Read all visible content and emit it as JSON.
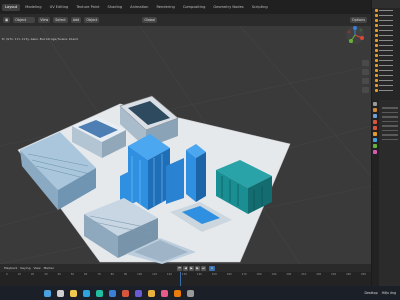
{
  "topbar": {
    "tabs": [
      "Layout",
      "Modeling",
      "UV Editing",
      "Texture Paint",
      "Shading",
      "Animation",
      "Rendering",
      "Compositing",
      "Geometry Nodes",
      "Scripting"
    ]
  },
  "viewport_header": {
    "mode": "Object",
    "view": "View",
    "select": "Select",
    "add": "Add",
    "object": "Object",
    "global": "Global",
    "options": "Options"
  },
  "viewport": {
    "filepath": "D:/Gfx-lll-City-Genn-Buildings/Scene.blend",
    "colors": {
      "background": "#3a3a3a",
      "ground": "#e6e9ec",
      "selected": "#2f8fe0",
      "building": "#8fb8d6",
      "teal": "#1a8f93"
    }
  },
  "timeline": {
    "playback": "Playback",
    "keying": "Keying",
    "view": "View",
    "marker": "Marker",
    "current_frame": "1",
    "ticks": [
      "0",
      "10",
      "20",
      "30",
      "40",
      "50",
      "60",
      "70",
      "80",
      "90",
      "100",
      "110",
      "120",
      "130",
      "140",
      "150",
      "160",
      "170",
      "180",
      "190",
      "200",
      "210",
      "220",
      "230",
      "240",
      "250"
    ]
  },
  "statusbar": {
    "taskbar_icons": [
      {
        "name": "start-icon",
        "color": "#4aa3e0"
      },
      {
        "name": "search-icon",
        "color": "#cfcfcf"
      },
      {
        "name": "explorer-icon",
        "color": "#f2c94c"
      },
      {
        "name": "browser-icon",
        "color": "#2fa3e0"
      },
      {
        "name": "edge-icon",
        "color": "#1fbfa0"
      },
      {
        "name": "mail-icon",
        "color": "#3b7fd6"
      },
      {
        "name": "app-icon",
        "color": "#d9553b"
      },
      {
        "name": "chat-icon",
        "color": "#6a5ad6"
      },
      {
        "name": "folder-icon",
        "color": "#e8b23d"
      },
      {
        "name": "media-icon",
        "color": "#e85a8a"
      },
      {
        "name": "blender-icon",
        "color": "#e87d0d"
      },
      {
        "name": "settings-icon",
        "color": "#9a9a9a"
      }
    ],
    "tray_label": "Desktop",
    "notification": "Hiệu ứng"
  }
}
